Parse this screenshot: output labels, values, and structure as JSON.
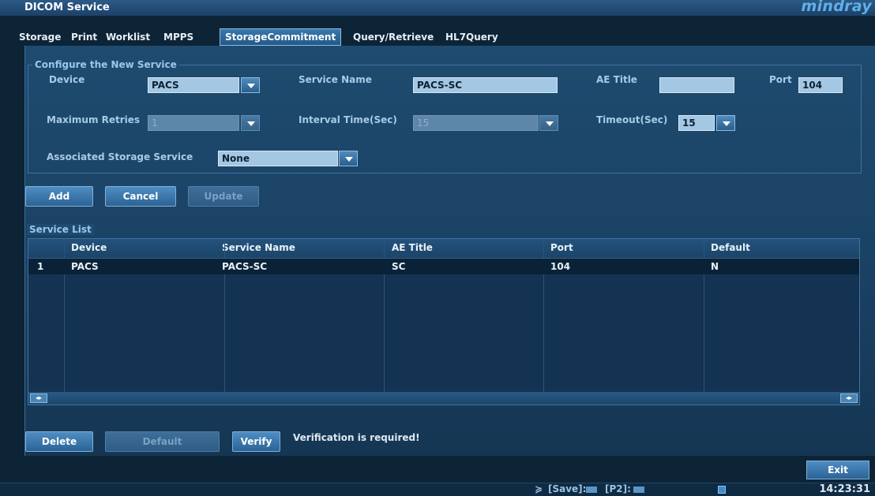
{
  "window": {
    "title": "DICOM Service",
    "brand": "mindray"
  },
  "tabs": [
    {
      "label": "Storage"
    },
    {
      "label": "Print"
    },
    {
      "label": "Worklist"
    },
    {
      "label": "MPPS"
    },
    {
      "label": "StorageCommitment",
      "active": true
    },
    {
      "label": "Query/Retrieve"
    },
    {
      "label": "HL7Query"
    }
  ],
  "config": {
    "group_title": "Configure the New Service",
    "device": {
      "label": "Device",
      "value": "PACS"
    },
    "service_name": {
      "label": "Service Name",
      "value": "PACS-SC"
    },
    "ae_title": {
      "label": "AE Title",
      "value": ""
    },
    "port": {
      "label": "Port",
      "value": "104"
    },
    "max_retries": {
      "label": "Maximum Retries",
      "value": "1"
    },
    "interval_time": {
      "label": "Interval Time(Sec)",
      "value": "15"
    },
    "timeout": {
      "label": "Timeout(Sec)",
      "value": "15"
    },
    "assoc_storage": {
      "label": "Associated Storage Service",
      "value": "None"
    }
  },
  "actions": {
    "add": "Add",
    "cancel": "Cancel",
    "update": "Update"
  },
  "service_list": {
    "title": "Service List",
    "columns": [
      "Device",
      "Service Name",
      "AE Title",
      "Port",
      "Default"
    ],
    "rows": [
      {
        "index": "1",
        "device": "PACS",
        "service_name": "PACS-SC",
        "ae_title": "SC",
        "port": "104",
        "default": "N"
      }
    ],
    "scroll_left": "◂▸",
    "scroll_right": "◂▸"
  },
  "bottom_actions": {
    "delete": "Delete",
    "default": "Default",
    "verify": "Verify"
  },
  "message": "Verification is required!",
  "exit": "Exit",
  "status": {
    "save": "[Save]:",
    "p2": "[P2]:",
    "time": "14:23:31",
    "scroll_glyph": "≽"
  },
  "colors": {
    "accent": "#2c6396",
    "panel": "#1e4b70",
    "field": "#a4c7e3",
    "brand": "#5fb0ea"
  }
}
